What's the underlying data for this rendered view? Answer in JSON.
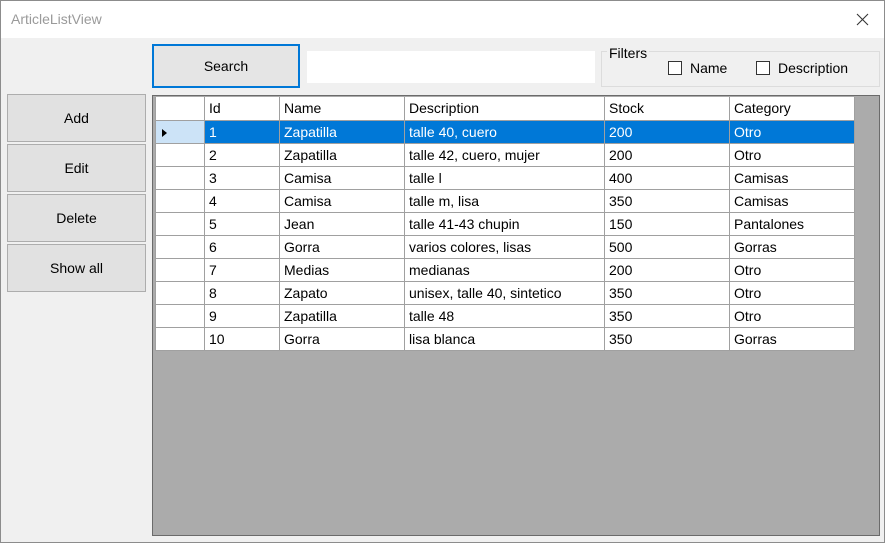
{
  "window": {
    "title": "ArticleListView"
  },
  "toolbar": {
    "search_label": "Search",
    "search_value": ""
  },
  "filters": {
    "label": "Filters",
    "name_label": "Name",
    "description_label": "Description",
    "name_checked": false,
    "description_checked": false
  },
  "side": {
    "add": "Add",
    "edit": "Edit",
    "delete": "Delete",
    "show_all": "Show all"
  },
  "table": {
    "columns": [
      "Id",
      "Name",
      "Description",
      "Stock",
      "Category"
    ],
    "selected_index": 0,
    "rows": [
      [
        "1",
        "Zapatilla",
        "talle 40, cuero",
        "200",
        "Otro"
      ],
      [
        "2",
        "Zapatilla",
        "talle 42, cuero, mujer",
        "200",
        "Otro"
      ],
      [
        "3",
        "Camisa",
        "talle l",
        "400",
        "Camisas"
      ],
      [
        "4",
        "Camisa",
        "talle m, lisa",
        "350",
        "Camisas"
      ],
      [
        "5",
        "Jean",
        "talle 41-43 chupin",
        "150",
        "Pantalones"
      ],
      [
        "6",
        "Gorra",
        "varios colores, lisas",
        "500",
        "Gorras"
      ],
      [
        "7",
        "Medias",
        "medianas",
        "200",
        "Otro"
      ],
      [
        "8",
        "Zapato",
        "unisex, talle 40, sintetico",
        "350",
        "Otro"
      ],
      [
        "9",
        "Zapatilla",
        "talle 48",
        "350",
        "Otro"
      ],
      [
        "10",
        "Gorra",
        "lisa blanca",
        "350",
        "Gorras"
      ]
    ]
  }
}
